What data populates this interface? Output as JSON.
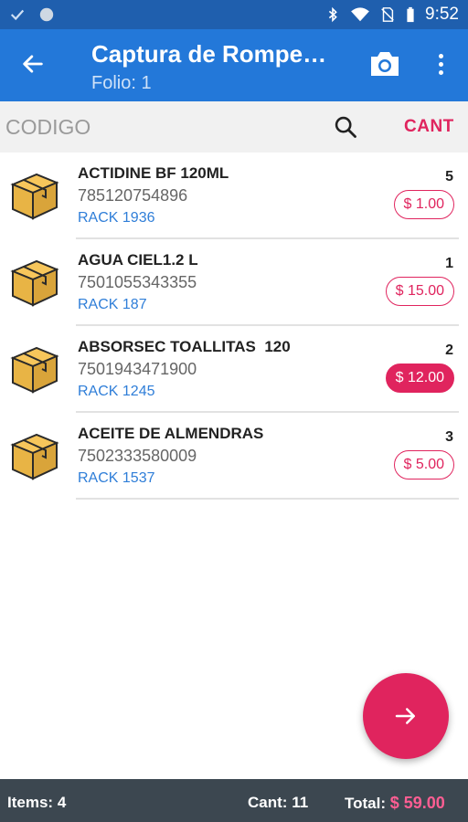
{
  "statusbar": {
    "time": "9:52",
    "icons": [
      "check-icon",
      "circle-icon",
      "bluetooth-icon",
      "wifi-icon",
      "no-sim-icon",
      "battery-icon"
    ]
  },
  "appbar": {
    "title": "Captura de Rompe…",
    "subtitle": "Folio: 1",
    "icons": [
      "back-arrow-icon",
      "camera-icon",
      "more-vert-icon"
    ]
  },
  "search": {
    "placeholder": "CODIGO",
    "cant_label": "CANT"
  },
  "items": [
    {
      "name": "ACTIDINE BF 120ML",
      "code": "785120754896",
      "rack": "RACK 1936",
      "qty": "5",
      "price": "$ 1.00",
      "selected": false
    },
    {
      "name": "AGUA CIEL1.2 L",
      "code": "7501055343355",
      "rack": "RACK 187",
      "qty": "1",
      "price": "$ 15.00",
      "selected": false
    },
    {
      "name": "ABSORSEC TOALLITAS  120",
      "code": "7501943471900",
      "rack": "RACK 1245",
      "qty": "2",
      "price": "$ 12.00",
      "selected": true
    },
    {
      "name": "ACEITE DE ALMENDRAS",
      "code": "7502333580009",
      "rack": "RACK 1537",
      "qty": "3",
      "price": "$ 5.00",
      "selected": false
    }
  ],
  "footer": {
    "items_label": "Items:",
    "items_value": "4",
    "cant_label": "Cant:",
    "cant_value": "11",
    "total_label": "Total:",
    "total_value": "$ 59.00"
  },
  "colors": {
    "statusbar": "#1f5fae",
    "appbar": "#2378d9",
    "accent": "#e0245e",
    "rack": "#2f7ed8",
    "footer": "#3c4750"
  }
}
